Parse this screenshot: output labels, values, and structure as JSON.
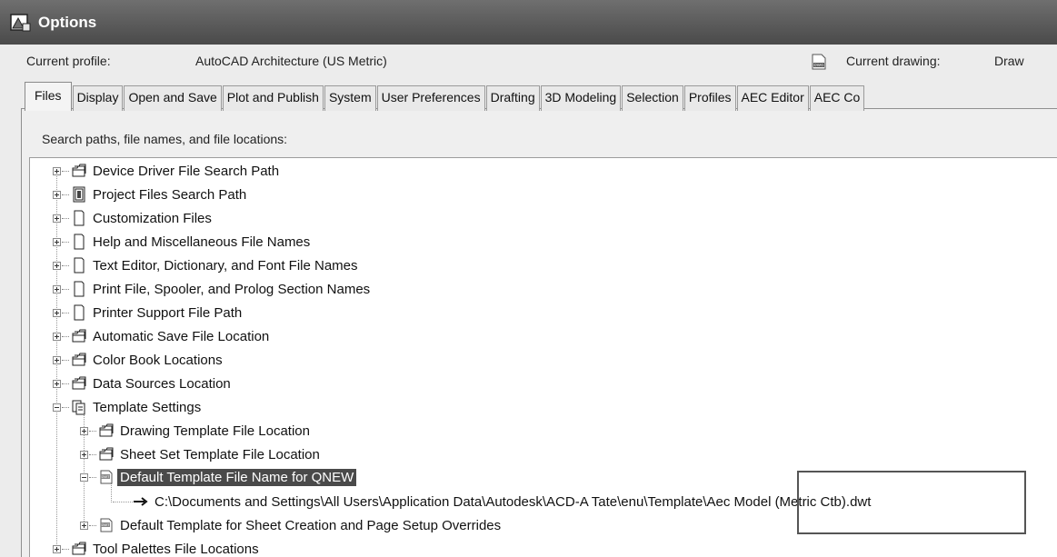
{
  "window": {
    "title": "Options",
    "icon": "options-icon"
  },
  "profile": {
    "current_profile_label": "Current profile:",
    "current_profile_value": "AutoCAD Architecture (US Metric)",
    "current_drawing_label": "Current drawing:",
    "current_drawing_value": "Draw",
    "drawing_icon": "dwg-file-icon"
  },
  "tabs": [
    {
      "label": "Files",
      "active": true
    },
    {
      "label": "Display"
    },
    {
      "label": "Open and Save"
    },
    {
      "label": "Plot and Publish"
    },
    {
      "label": "System"
    },
    {
      "label": "User Preferences"
    },
    {
      "label": "Drafting"
    },
    {
      "label": "3D Modeling"
    },
    {
      "label": "Selection"
    },
    {
      "label": "Profiles"
    },
    {
      "label": "AEC Editor"
    },
    {
      "label": "AEC Co"
    }
  ],
  "files": {
    "section_label": "Search paths, file names, and file locations:",
    "tree": [
      {
        "label": "Device Driver File Search Path",
        "icon": "folder-stack-icon"
      },
      {
        "label": "Project Files Search Path",
        "icon": "project-file-icon"
      },
      {
        "label": "Customization Files",
        "icon": "document-icon"
      },
      {
        "label": "Help and Miscellaneous File Names",
        "icon": "document-icon"
      },
      {
        "label": "Text Editor, Dictionary, and Font File Names",
        "icon": "document-icon"
      },
      {
        "label": "Print File, Spooler, and Prolog Section Names",
        "icon": "document-icon"
      },
      {
        "label": "Printer Support File Path",
        "icon": "document-icon"
      },
      {
        "label": "Automatic Save File Location",
        "icon": "folder-stack-icon"
      },
      {
        "label": "Color Book Locations",
        "icon": "folder-stack-icon"
      },
      {
        "label": "Data Sources Location",
        "icon": "folder-stack-icon"
      },
      {
        "label": "Template Settings",
        "icon": "template-settings-icon",
        "expanded": true
      },
      {
        "label": "Drawing Template File Location",
        "icon": "folder-stack-icon",
        "level": 2
      },
      {
        "label": "Sheet Set Template File Location",
        "icon": "folder-stack-icon",
        "level": 2
      },
      {
        "label": "Default Template File Name for QNEW",
        "icon": "dwt-file-icon",
        "level": 2,
        "expanded": true,
        "selected": true
      },
      {
        "label": "C:\\Documents and Settings\\All Users\\Application Data\\Autodesk\\ACD-A Tate\\enu\\Template\\Aec Model (Metric Ctb).dwt",
        "icon": "arrow-right-icon",
        "level": 3
      },
      {
        "label": "Default Template for Sheet Creation and Page Setup Overrides",
        "icon": "dwt-file-icon",
        "level": 2
      },
      {
        "label": "Tool Palettes File Locations",
        "icon": "folder-stack-icon"
      }
    ]
  }
}
